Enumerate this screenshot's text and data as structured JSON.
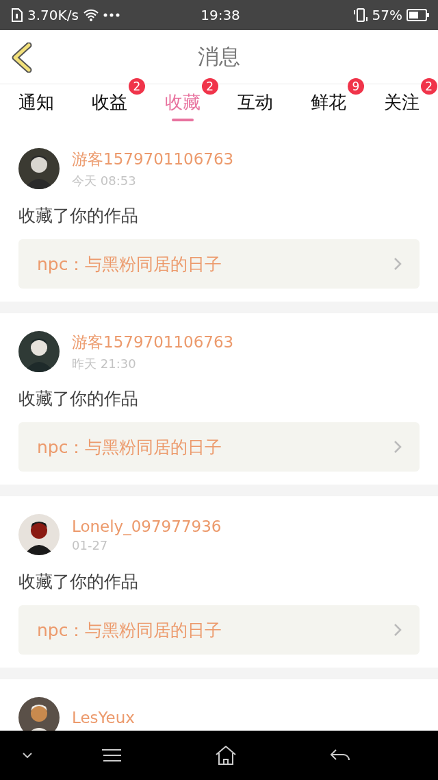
{
  "status_bar": {
    "speed": "3.70K/s",
    "time": "19:38",
    "battery": "57%"
  },
  "header": {
    "title": "消息"
  },
  "tabs": [
    {
      "label": "通知",
      "selected": false
    },
    {
      "label": "收益",
      "selected": false,
      "badge": "2"
    },
    {
      "label": "收藏",
      "selected": true,
      "badge": "2"
    },
    {
      "label": "互动",
      "selected": false
    },
    {
      "label": "鲜花",
      "selected": false,
      "badge": "9"
    },
    {
      "label": "关注",
      "selected": false,
      "badge": "2"
    }
  ],
  "messages": [
    {
      "user": "游客1579701106763",
      "time": "今天 08:53",
      "text": "收藏了你的作品",
      "work": "npc：与黑粉同居的日子"
    },
    {
      "user": "游客1579701106763",
      "time": "昨天 21:30",
      "text": "收藏了你的作品",
      "work": "npc：与黑粉同居的日子"
    },
    {
      "user": "Lonely_097977936",
      "time": "01-27",
      "text": "收藏了你的作品",
      "work": "npc：与黑粉同居的日子"
    },
    {
      "user": "LesYeux"
    }
  ]
}
